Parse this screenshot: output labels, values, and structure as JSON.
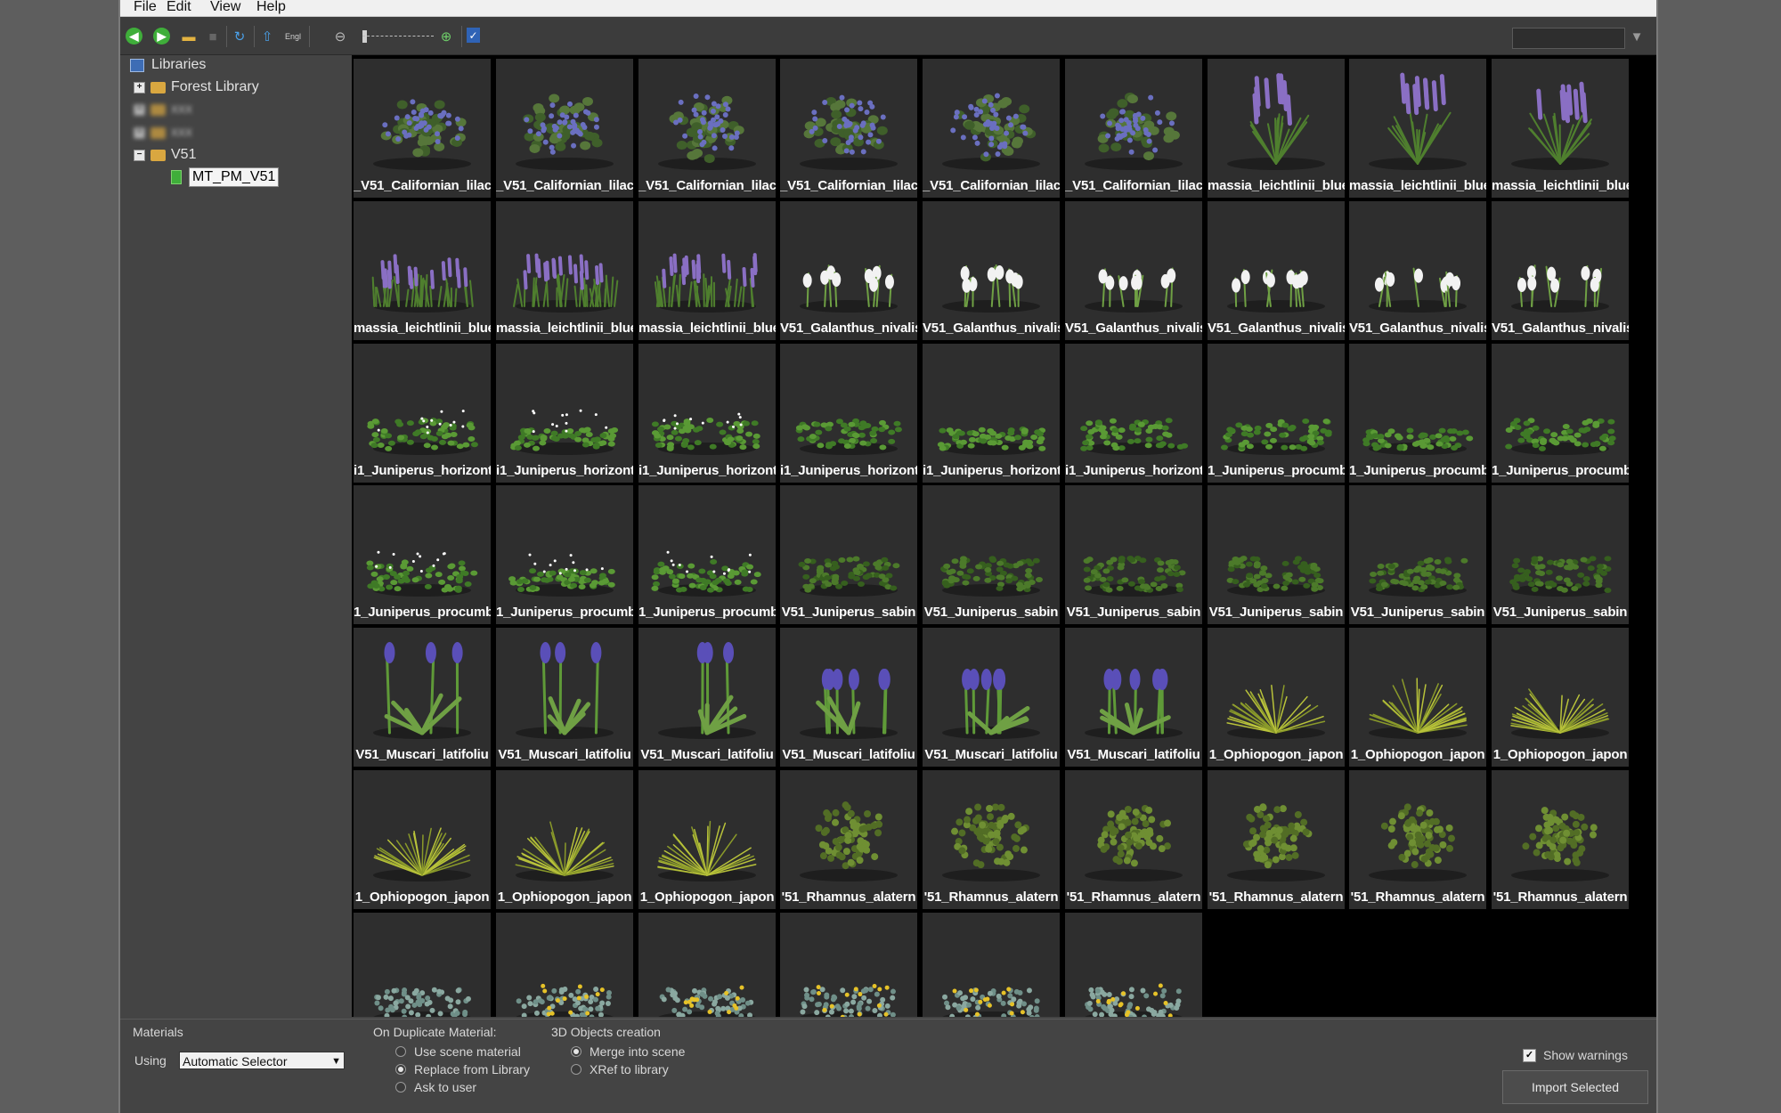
{
  "menu": [
    "File",
    "Edit",
    "View",
    "Help"
  ],
  "toolbar_icons": [
    "back-arrow",
    "forward-arrow",
    "open-folder",
    "save-disk",
    "refresh",
    "sort-up",
    "english-language",
    "zoom-out",
    "thumbnail-size-slider",
    "zoom-in",
    "checklist"
  ],
  "tree": {
    "root": "Libraries",
    "forest": "Forest Library",
    "hidden1": "ххх",
    "hidden2": "ххх",
    "v51": "V51",
    "selected": "MT_PM_V51"
  },
  "grid": {
    "rows": [
      [
        "_V51_Californian_lilac",
        "_V51_Californian_lilac",
        "_V51_Californian_lilac",
        "_V51_Californian_lilac",
        "_V51_Californian_lilac",
        "_V51_Californian_lilac",
        "massia_leichtlinii_blue",
        "massia_leichtlinii_blue",
        "massia_leichtlinii_blue"
      ],
      [
        "massia_leichtlinii_blue",
        "massia_leichtlinii_blue",
        "massia_leichtlinii_blue",
        "V51_Galanthus_nivalis",
        "V51_Galanthus_nivalis",
        "V51_Galanthus_nivalis",
        "V51_Galanthus_nivalis",
        "V51_Galanthus_nivalis",
        "V51_Galanthus_nivalis"
      ],
      [
        "i1_Juniperus_horizont",
        "i1_Juniperus_horizont",
        "i1_Juniperus_horizont",
        "i1_Juniperus_horizont",
        "i1_Juniperus_horizont",
        "i1_Juniperus_horizont",
        "1_Juniperus_procumb",
        "1_Juniperus_procumb",
        "1_Juniperus_procumb"
      ],
      [
        "1_Juniperus_procumb",
        "1_Juniperus_procumb",
        "1_Juniperus_procumb",
        "V51_Juniperus_sabin",
        "V51_Juniperus_sabin",
        "V51_Juniperus_sabin",
        "V51_Juniperus_sabin",
        "V51_Juniperus_sabin",
        "V51_Juniperus_sabin"
      ],
      [
        "V51_Muscari_latifoliu",
        "V51_Muscari_latifoliu",
        "V51_Muscari_latifoliu",
        "V51_Muscari_latifoliu",
        "V51_Muscari_latifoliu",
        "V51_Muscari_latifoliu",
        "1_Ophiopogon_japon",
        "1_Ophiopogon_japon",
        "1_Ophiopogon_japon"
      ],
      [
        "1_Ophiopogon_japon",
        "1_Ophiopogon_japon",
        "1_Ophiopogon_japon",
        "'51_Rhamnus_alatern",
        "'51_Rhamnus_alatern",
        "'51_Rhamnus_alatern",
        "'51_Rhamnus_alatern",
        "'51_Rhamnus_alatern",
        "'51_Rhamnus_alatern"
      ],
      [
        "",
        "",
        "",
        "",
        "",
        ""
      ]
    ],
    "row_kinds": [
      "lilac",
      "mixed1",
      "juniper_h",
      "juniper_s",
      "muscari",
      "rhamnus",
      "last"
    ]
  },
  "bottom": {
    "materials_title": "Materials",
    "using_label": "Using",
    "selector_value": "Automatic Selector",
    "dup_title": "On Duplicate Material:",
    "dup_options": [
      "Use scene material",
      "Replace from Library",
      "Ask to user"
    ],
    "dup_selected": 1,
    "obj_title": "3D Objects creation",
    "obj_options": [
      "Merge into scene",
      "XRef to library"
    ],
    "obj_selected": 0,
    "show_warnings": "Show warnings",
    "import_button": "Import Selected"
  },
  "colors": {
    "lilac_flower": "#6a6fc0",
    "lavender": "#8a6fc4",
    "snowdrop": "#f2f2f2",
    "foliage": "#4f7f2e",
    "juniper": "#5a9a35",
    "muscari": "#5a4fb8",
    "ophiopogon": "#b8c23a",
    "rhamnus": "#6f8f33",
    "yellow_flower": "#e6c228"
  }
}
